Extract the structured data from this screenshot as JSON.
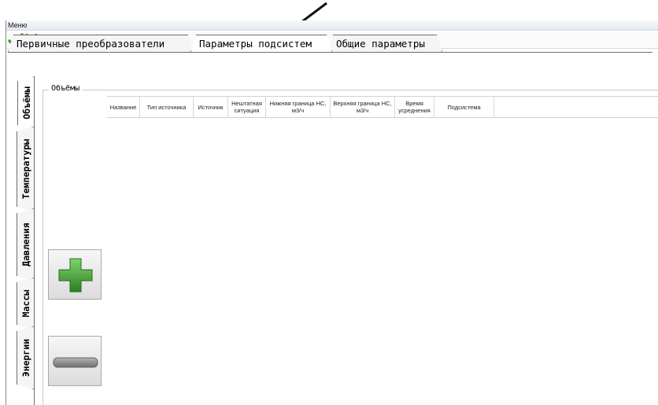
{
  "menubar": {
    "menu_label": "Меню"
  },
  "toolbar": {
    "confirm_icon": "checkmark-icon",
    "cancel_icon": "cross-icon",
    "colors": {
      "confirm": "#3fa52c",
      "cancel": "#d9362b"
    }
  },
  "top_tabs": [
    {
      "label": "Первичные преобразователи",
      "active": false
    },
    {
      "label": "Параметры подсистем",
      "active": true
    },
    {
      "label": "Общие параметры",
      "active": false
    }
  ],
  "side_tabs": [
    {
      "label": "Объёмы",
      "active": true
    },
    {
      "label": "Температуры",
      "active": false
    },
    {
      "label": "Давления",
      "active": false
    },
    {
      "label": "Массы",
      "active": false
    },
    {
      "label": "Энергии",
      "active": false
    }
  ],
  "group": {
    "title": "Объёмы"
  },
  "table": {
    "columns": [
      "Название",
      "Тип источника",
      "Источник",
      "Нештатная ситуация",
      "Нижняя граница НС, м3/ч",
      "Верхняя граница НС, м3/ч",
      "Время усреднения",
      "Подсистема"
    ],
    "rows": []
  },
  "buttons": {
    "add_icon": "plus-icon",
    "remove_icon": "minus-icon",
    "colors": {
      "add": "#3f9b35",
      "remove": "#8c8c8c"
    }
  },
  "annotation": {
    "arrow_icon": "pointer-arrow-icon",
    "color": "#111111"
  }
}
